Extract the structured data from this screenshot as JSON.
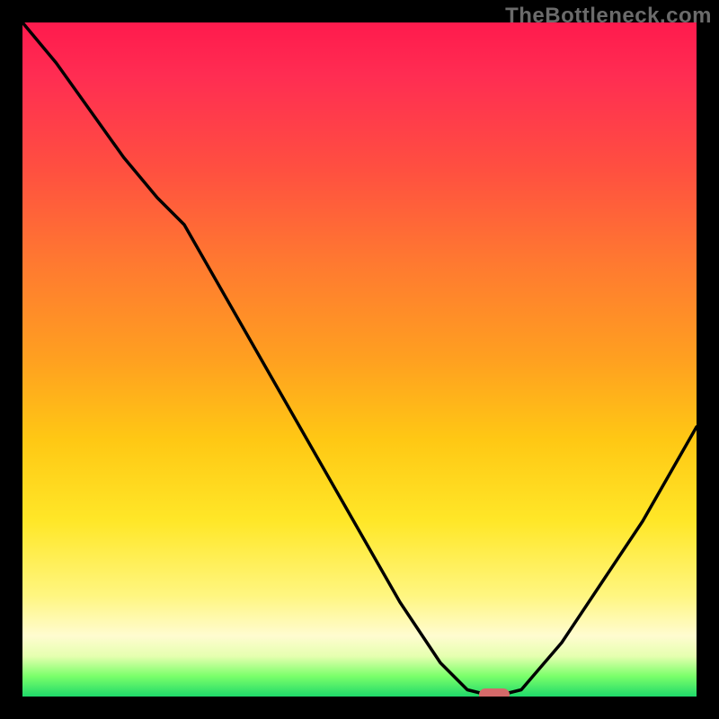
{
  "watermark": "TheBottleneck.com",
  "marker": {
    "x_frac": 0.7,
    "y_frac": 0.997
  },
  "chart_data": {
    "type": "line",
    "title": "",
    "xlabel": "",
    "ylabel": "",
    "xlim": [
      0,
      1
    ],
    "ylim": [
      0,
      1
    ],
    "series": [
      {
        "name": "bottleneck-curve",
        "x": [
          0.0,
          0.05,
          0.1,
          0.15,
          0.2,
          0.24,
          0.32,
          0.4,
          0.48,
          0.56,
          0.62,
          0.66,
          0.7,
          0.74,
          0.8,
          0.86,
          0.92,
          1.0
        ],
        "y": [
          1.0,
          0.94,
          0.87,
          0.8,
          0.74,
          0.7,
          0.56,
          0.42,
          0.28,
          0.14,
          0.05,
          0.01,
          0.0,
          0.01,
          0.08,
          0.17,
          0.26,
          0.4
        ]
      }
    ],
    "annotations": [
      {
        "name": "optimal-marker",
        "x": 0.7,
        "y": 0.003
      }
    ]
  }
}
